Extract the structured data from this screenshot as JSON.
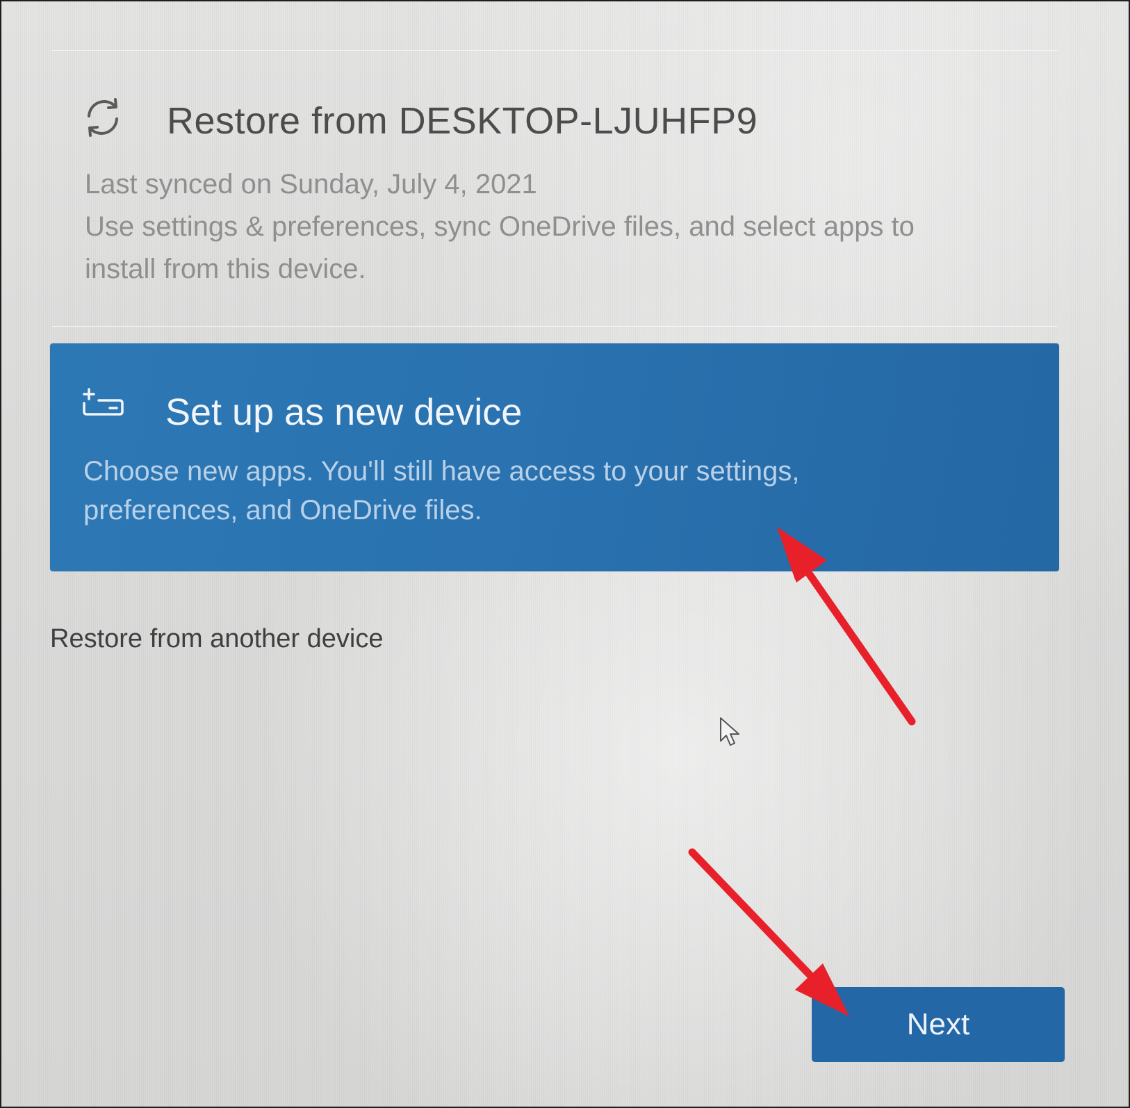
{
  "restore_option": {
    "icon": "sync-icon",
    "title": "Restore from DESKTOP-LJUHFP9",
    "last_synced": "Last synced on Sunday, July 4, 2021",
    "description_line1": "Use settings & preferences, sync OneDrive files, and select apps to",
    "description_line2": "install from this device."
  },
  "new_device_option": {
    "icon": "new-device-icon",
    "title": "Set up as new device",
    "description_line1": "Choose new apps. You'll still have access to your settings,",
    "description_line2": "preferences, and OneDrive files.",
    "selected": true,
    "background_color": "#2a72b0"
  },
  "other_device_link": "Restore from another device",
  "next_button": {
    "label": "Next",
    "color": "#2467a6"
  },
  "annotation_color": "#e8202a"
}
